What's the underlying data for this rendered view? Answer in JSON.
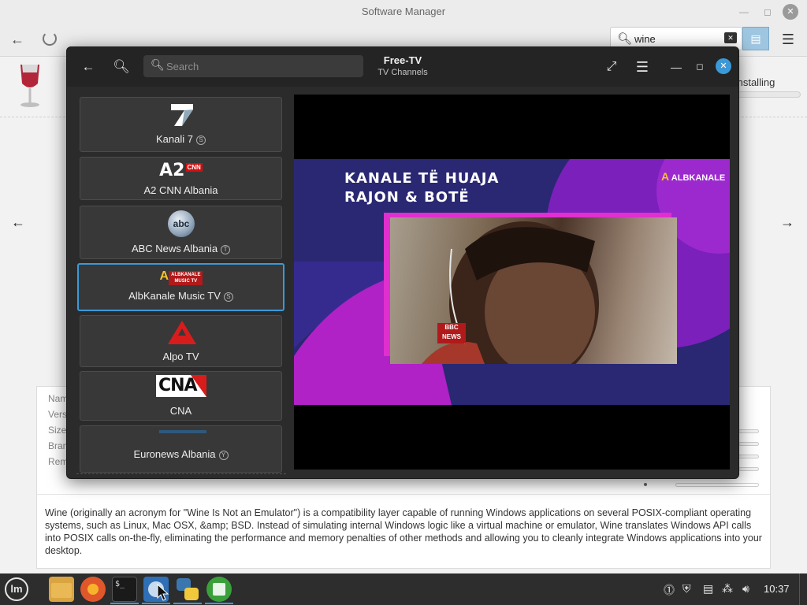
{
  "software_manager": {
    "title": "Software Manager",
    "search_value": "wine",
    "installing_label": "Installing",
    "installing_progress": 0.0,
    "detail_labels": [
      "Name",
      "Version",
      "Size",
      "Branch",
      "Remotes"
    ],
    "description": "Wine (originally an acronym for \"Wine Is Not an Emulator\") is a compatibility layer capable of running Windows applications on several POSIX-compliant operating systems, such as Linux, Mac OSX, &amp; BSD. Instead of simulating internal Windows logic like a virtual machine or emulator, Wine translates Windows API calls into POSIX calls on-the-fly, eliminating the performance and memory penalties of other methods and allowing you to cleanly integrate Windows applications into your desktop."
  },
  "freetv": {
    "title": "Free-TV",
    "subtitle": "TV Channels",
    "search_placeholder": "Search",
    "channels": [
      {
        "name": "Kanali 7",
        "badge": "S",
        "logo": "7"
      },
      {
        "name": "A2 CNN Albania",
        "badge": "",
        "logo": "A2"
      },
      {
        "name": "ABC News Albania",
        "badge": "T",
        "logo": "abc"
      },
      {
        "name": "AlbKanale Music TV",
        "badge": "S",
        "logo": "ALBKANALE MUSIC TV",
        "active": true
      },
      {
        "name": "Alpo TV",
        "badge": "",
        "logo": "A"
      },
      {
        "name": "CNA",
        "badge": "",
        "logo": "CNA"
      },
      {
        "name": "Euronews Albania",
        "badge": "Y",
        "logo": ""
      }
    ],
    "video": {
      "headline_line1": "KANALE TË HUAJA",
      "headline_line2": "RAJON & BOTË",
      "brand": "ALBKANALE",
      "bbc_label_top": "BBC",
      "bbc_label_bottom": "NEWS"
    }
  },
  "taskbar": {
    "clock": "10:37",
    "apps": [
      "files",
      "firefox",
      "terminal",
      "freetv",
      "python",
      "calc"
    ]
  },
  "colors": {
    "accent": "#3b99d8",
    "dark_window": "#2b2b2b",
    "video_bg": "#2a2773",
    "video_frame": "#e02fce",
    "taskbar": "#2d2d2d"
  }
}
